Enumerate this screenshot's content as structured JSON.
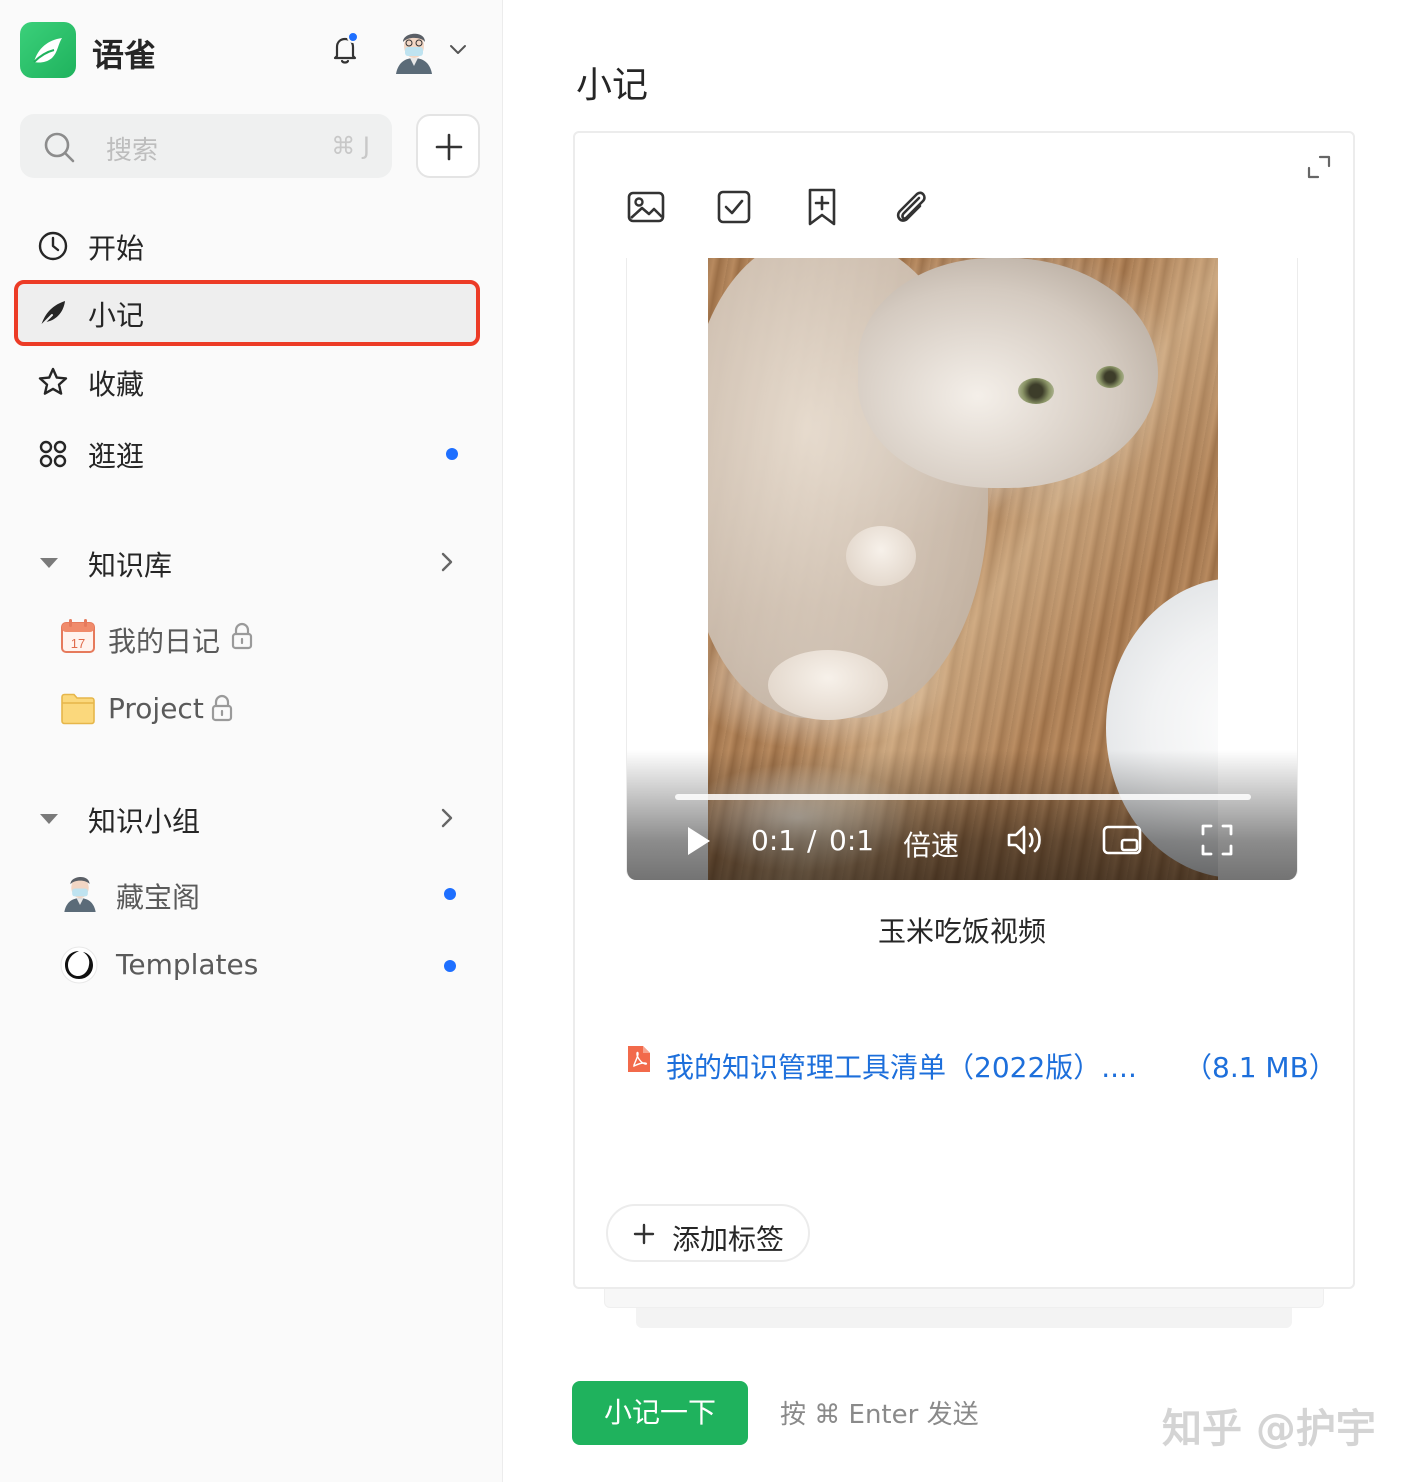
{
  "app": {
    "title": "语雀",
    "notification_dot_color": "#1e6fff",
    "brand_color": "#1fb25d"
  },
  "search": {
    "placeholder": "搜索",
    "shortcut": "⌘ J"
  },
  "nav": [
    {
      "label": "开始",
      "icon": "clock-icon",
      "active": false,
      "unread": false
    },
    {
      "label": "小记",
      "icon": "feather-icon",
      "active": true,
      "unread": false
    },
    {
      "label": "收藏",
      "icon": "star-icon",
      "active": false,
      "unread": false
    },
    {
      "label": "逛逛",
      "icon": "explore-icon",
      "active": false,
      "unread": true
    }
  ],
  "sections": {
    "library": {
      "title": "知识库",
      "items": [
        {
          "label": "我的日记",
          "icon": "calendar-icon",
          "calendar_day": "17",
          "locked": true
        },
        {
          "label": "Project",
          "icon": "folder-icon",
          "locked": true
        }
      ]
    },
    "groups": {
      "title": "知识小组",
      "items": [
        {
          "label": "藏宝阁",
          "icon": "avatar-icon",
          "unread": true
        },
        {
          "label": "Templates",
          "icon": "ring-logo-icon",
          "unread": true
        }
      ]
    }
  },
  "main": {
    "title": "小记",
    "toolbar": [
      "image-icon",
      "checkbox-icon",
      "bookmark-plus-icon",
      "paperclip-icon"
    ],
    "video": {
      "current_time": "0:1",
      "separator": "/",
      "duration": "0:1",
      "speed_label": "倍速",
      "progress": 1.0
    },
    "video_caption": "玉米吃饭视频",
    "attachment": {
      "name": "我的知识管理工具清单（2022版）....",
      "size": "（8.1 MB）",
      "link_color": "#1d6fdb"
    },
    "add_tag_label": "添加标签",
    "send_button": "小记一下",
    "send_hint": "按 ⌘ Enter 发送"
  },
  "watermark": "知乎 @护宇"
}
